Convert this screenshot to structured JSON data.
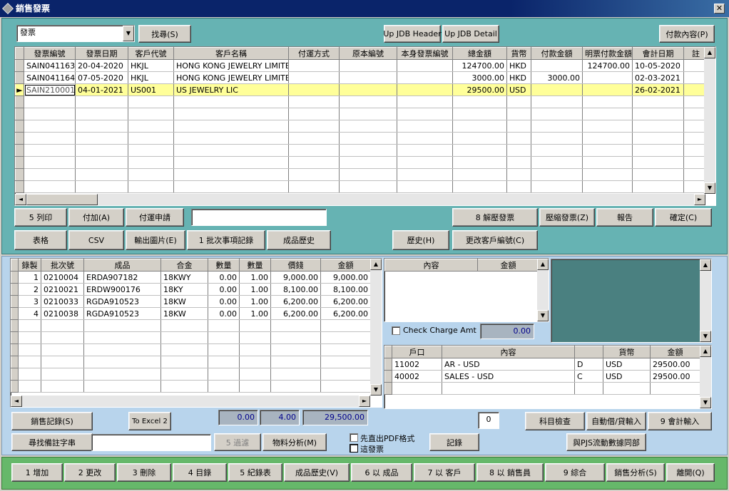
{
  "window": {
    "title": "銷售發票"
  },
  "top": {
    "combo_value": "發票",
    "search_button": "找尋(S)",
    "up_jdb_header": "Up JDB Header",
    "up_jdb_detail": "Up JDB Detail",
    "payment_content": "付款內容(P)",
    "columns": [
      "發票編號",
      "發票日期",
      "客戶代號",
      "客戶名稱",
      "付運方式",
      "原本編號",
      "本身發票編號",
      "總金額",
      "貨幣",
      "付款金額",
      "明票付款金額",
      "會計日期",
      "註"
    ],
    "rows": [
      [
        "SAIN041163",
        "20-04-2020",
        "HKJL",
        "HONG KONG JEWELRY LIMITE",
        "",
        "",
        "",
        "124700.00",
        "HKD",
        "",
        "124700.00",
        "10-05-2020",
        ""
      ],
      [
        "SAIN041164",
        "07-05-2020",
        "HKJL",
        "HONG KONG JEWELRY LIMITE",
        "",
        "",
        "",
        "3000.00",
        "HKD",
        "3000.00",
        "",
        "02-03-2021",
        ""
      ],
      [
        "SAIN210001",
        "04-01-2021",
        "US001",
        "US JEWELRY LIC",
        "",
        "",
        "",
        "29500.00",
        "USD",
        "",
        "",
        "26-02-2021",
        ""
      ]
    ],
    "buttons_row1": [
      "5 列印",
      "付加(A)",
      "付運申請"
    ],
    "buttons_row1_right": [
      "8 解壓發票",
      "壓縮發票(Z)",
      "報告",
      "確定(C)"
    ],
    "buttons_row2": [
      "表格",
      "CSV",
      "輸出圖片(E)",
      "1 批次事項記錄",
      "成品歷史"
    ],
    "buttons_row2_right": [
      "歷史(H)",
      "更改客戶編號(C)"
    ]
  },
  "detail": {
    "columns": [
      "錄製",
      "批次號",
      "成品",
      "合金",
      "數量",
      "數量",
      "價錢",
      "金額"
    ],
    "rows": [
      [
        "1",
        "0210004",
        "ERDA907182",
        "18KWY",
        "0.00",
        "1.00",
        "9,000.00",
        "9,000.00"
      ],
      [
        "2",
        "0210021",
        "ERDW900176",
        "18KY",
        "0.00",
        "1.00",
        "8,100.00",
        "8,100.00"
      ],
      [
        "3",
        "0210033",
        "RGDA910523",
        "18KW",
        "0.00",
        "1.00",
        "6,200.00",
        "6,200.00"
      ],
      [
        "4",
        "0210038",
        "RGDA910523",
        "18KW",
        "0.00",
        "1.00",
        "6,200.00",
        "6,200.00"
      ]
    ],
    "charge_columns": [
      "內容",
      "金額"
    ],
    "check_charge_label": "Check Charge Amt",
    "check_charge_value": "0.00",
    "acct_columns": [
      "戶口",
      "內容",
      "",
      "貨幣",
      "金額"
    ],
    "acct_rows": [
      [
        "11002",
        "AR - USD",
        "D",
        "USD",
        "29500.00"
      ],
      [
        "40002",
        "SALES - USD",
        "C",
        "USD",
        "29500.00"
      ]
    ],
    "sales_record_btn": "銷售記錄(S)",
    "to_excel": "To Excel 2",
    "total1": "0.00",
    "total2": "4.00",
    "total3": "29,500.00",
    "search_remarks_btn": "尋找備註字串",
    "filter_btn": "5 過濾",
    "material_btn": "物料分析(M)",
    "pdf_label": "先直出PDF格式",
    "this_invoice_label": "這發票",
    "record_btn": "記錄",
    "count_value": "0",
    "subject_check": "科目檢查",
    "auto_dr_cr": "自動借/貸輸入",
    "acct_input": "9 會計輸入",
    "sync_pjs": "與PJS流動數據同部"
  },
  "bottom": {
    "buttons": [
      "1 增加",
      "2 更改",
      "3 刪除",
      "4 目錄",
      "5 紀錄表",
      "成品歷史(V)",
      "6 以 成品",
      "7 以 客戶",
      "8 以 銷售員",
      "9 綜合",
      "銷售分析(S)",
      "離開(Q)"
    ]
  }
}
